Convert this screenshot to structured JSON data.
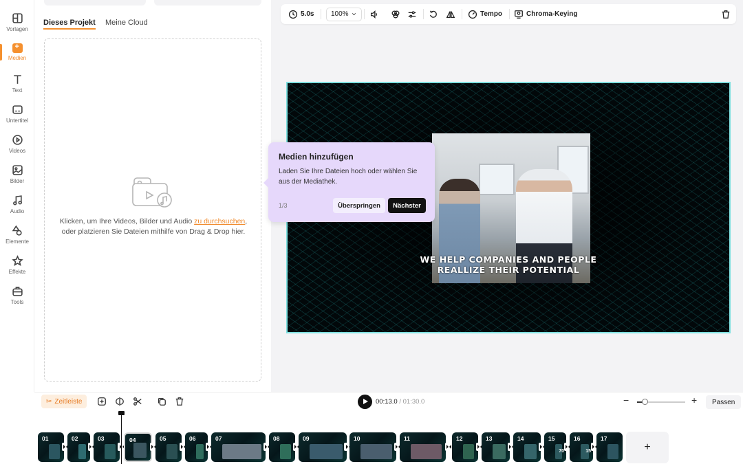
{
  "sidebar": {
    "items": [
      {
        "label": "Vorlagen",
        "icon": "templates-icon"
      },
      {
        "label": "Medien",
        "icon": "media-icon",
        "active": true
      },
      {
        "label": "Text",
        "icon": "text-icon"
      },
      {
        "label": "Untertitel",
        "icon": "subtitles-icon"
      },
      {
        "label": "Videos",
        "icon": "videos-icon"
      },
      {
        "label": "Bilder",
        "icon": "images-icon"
      },
      {
        "label": "Audio",
        "icon": "audio-icon"
      },
      {
        "label": "Elemente",
        "icon": "elements-icon"
      },
      {
        "label": "Effekte",
        "icon": "effects-icon"
      },
      {
        "label": "Tools",
        "icon": "tools-icon"
      }
    ]
  },
  "media_panel": {
    "tabs": [
      {
        "label": "Dieses Projekt",
        "active": true
      },
      {
        "label": "Meine Cloud"
      }
    ],
    "dropzone": {
      "text_before": "Klicken, um Ihre Videos, Bilder und Audio ",
      "link": "zu durchsuchen",
      "text_after": ", oder platzieren Sie Dateien mithilfe von Drag & Drop hier."
    }
  },
  "toolbar": {
    "duration": "5.0s",
    "zoom": "100%",
    "tempo_label": "Tempo",
    "chroma_label": "Chroma-Keying"
  },
  "canvas": {
    "headline_line1": "WE HELP COMPANIES AND PEOPLE",
    "headline_line2": "REALLIZE THEIR POTENTIAL"
  },
  "popover": {
    "title": "Medien hinzufügen",
    "body": "Laden Sie Ihre Dateien hoch oder wählen Sie aus der Mediathek.",
    "step": "1/3",
    "skip_label": "Überspringen",
    "next_label": "Nächster"
  },
  "timeline": {
    "label": "Zeitleiste",
    "current_time": "00:13.0",
    "total_time": "/ 01:30.0",
    "fit_label": "Passen",
    "zoom_minus": "−",
    "zoom_plus": "+",
    "add_label": "+",
    "zoom_level": 0.15,
    "clips": [
      {
        "num": "01"
      },
      {
        "num": "02"
      },
      {
        "num": "03"
      },
      {
        "num": "04",
        "selected": true
      },
      {
        "num": "05"
      },
      {
        "num": "06"
      },
      {
        "num": "07"
      },
      {
        "num": "08"
      },
      {
        "num": "09"
      },
      {
        "num": "10"
      },
      {
        "num": "11"
      },
      {
        "num": "12"
      },
      {
        "num": "13"
      },
      {
        "num": "14"
      },
      {
        "num": "15",
        "badge": "70"
      },
      {
        "num": "16",
        "badge": "15"
      },
      {
        "num": "17"
      }
    ]
  },
  "colors": {
    "accent": "#f5902e",
    "popover_bg": "#e6d8fb",
    "canvas_border": "#7fe0e0"
  }
}
